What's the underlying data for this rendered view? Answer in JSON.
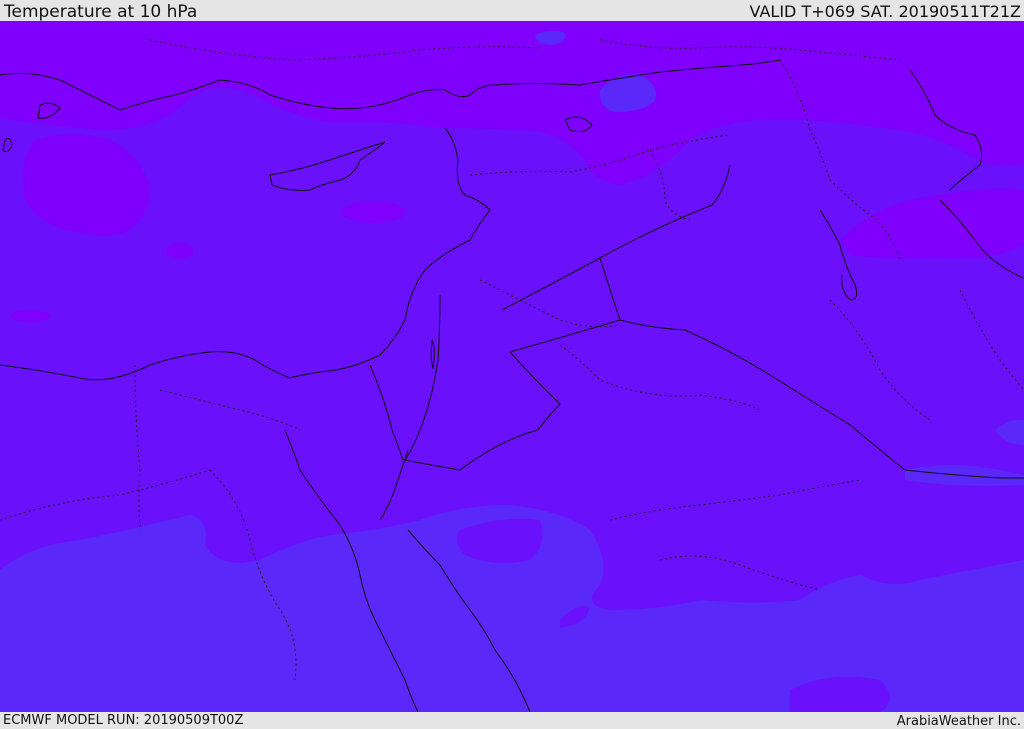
{
  "header": {
    "title": "Temperature at 10 hPa",
    "valid": "VALID T+069 SAT. 20190511T21Z"
  },
  "footer": {
    "model_run": "ECMWF MODEL RUN: 20190509T00Z",
    "brand": "ArabiaWeather Inc."
  },
  "map": {
    "colors": {
      "band_warm": "#8000fe",
      "band_mid": "#6a10fb",
      "band_cool": "#5a28f8",
      "coast": "#111111",
      "border": "#222222"
    }
  }
}
